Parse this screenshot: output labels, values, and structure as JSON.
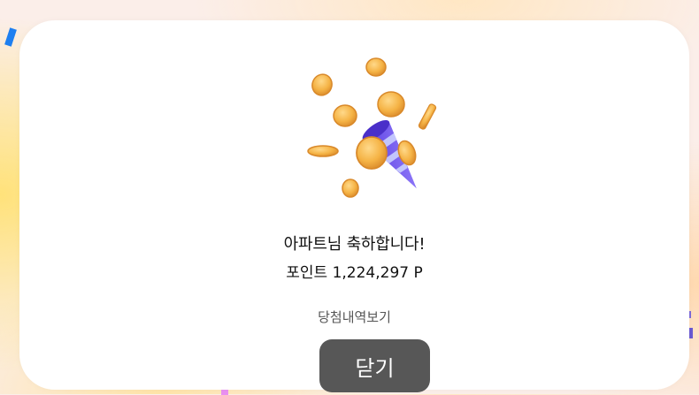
{
  "modal": {
    "title": "아파트님 축하합니다!",
    "points_text": "포인트 1,224,297 P",
    "history_link": "당첨내역보기",
    "close_label": "닫기"
  },
  "illustration": {
    "icon": "party-popper-with-coins",
    "colors": {
      "coin": "#f5b345",
      "coin_edge": "#d9892a",
      "popper": "#7a5cf0",
      "popper_stripe": "#c9d4ff"
    }
  },
  "background": {
    "confetti_colors": [
      "#1e7ff0",
      "#7d6bd9",
      "#e98ff0"
    ]
  }
}
